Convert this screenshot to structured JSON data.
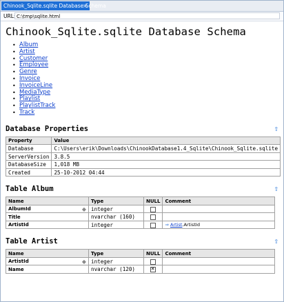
{
  "window": {
    "tab_title": "Chinook_Sqlite.sqlite Database Schema",
    "close_glyph": "×"
  },
  "urlbar": {
    "label": "URL:",
    "value": "C:\\tmp\\sqlite.html"
  },
  "page": {
    "title": "Chinook_Sqlite.sqlite Database Schema"
  },
  "toc": [
    "Album",
    "Artist",
    "Customer",
    "Employee",
    "Genre",
    "Invoice",
    "InvoiceLine",
    "MediaType",
    "Playlist",
    "PlaylistTrack",
    "Track"
  ],
  "up_glyph": "⇧",
  "db_properties": {
    "heading": "Database Properties",
    "columns": [
      "Property",
      "Value"
    ],
    "rows": [
      [
        "Database",
        "C:\\Users\\erik\\Downloads\\ChinookDatabase1.4_Sqlite\\Chinook_Sqlite.sqlite"
      ],
      [
        "ServerVersion",
        "3.8.5"
      ],
      [
        "DatabaseSize",
        "1,018 MB"
      ],
      [
        "Created",
        "25-10-2012 04:44"
      ]
    ]
  },
  "table_album": {
    "heading": "Table Album",
    "columns": [
      "Name",
      "Type",
      "NULL",
      "Comment"
    ],
    "rows": [
      {
        "name": "AlbumId",
        "type": "integer",
        "key": true,
        "nullable": false,
        "comment": ""
      },
      {
        "name": "Title",
        "type": "nvarchar (160)",
        "key": false,
        "nullable": false,
        "comment": ""
      },
      {
        "name": "ArtistId",
        "type": "integer",
        "key": false,
        "nullable": false,
        "fk_arrow": "⇒",
        "fk_link": "Artist",
        "fk_field": ".ArtistId"
      }
    ]
  },
  "table_artist": {
    "heading": "Table Artist",
    "columns": [
      "Name",
      "Type",
      "NULL",
      "Comment"
    ],
    "rows": [
      {
        "name": "ArtistId",
        "type": "integer",
        "key": true,
        "nullable": false,
        "comment": ""
      },
      {
        "name": "Name",
        "type": "nvarchar (120)",
        "key": false,
        "nullable": true,
        "comment": ""
      }
    ]
  }
}
